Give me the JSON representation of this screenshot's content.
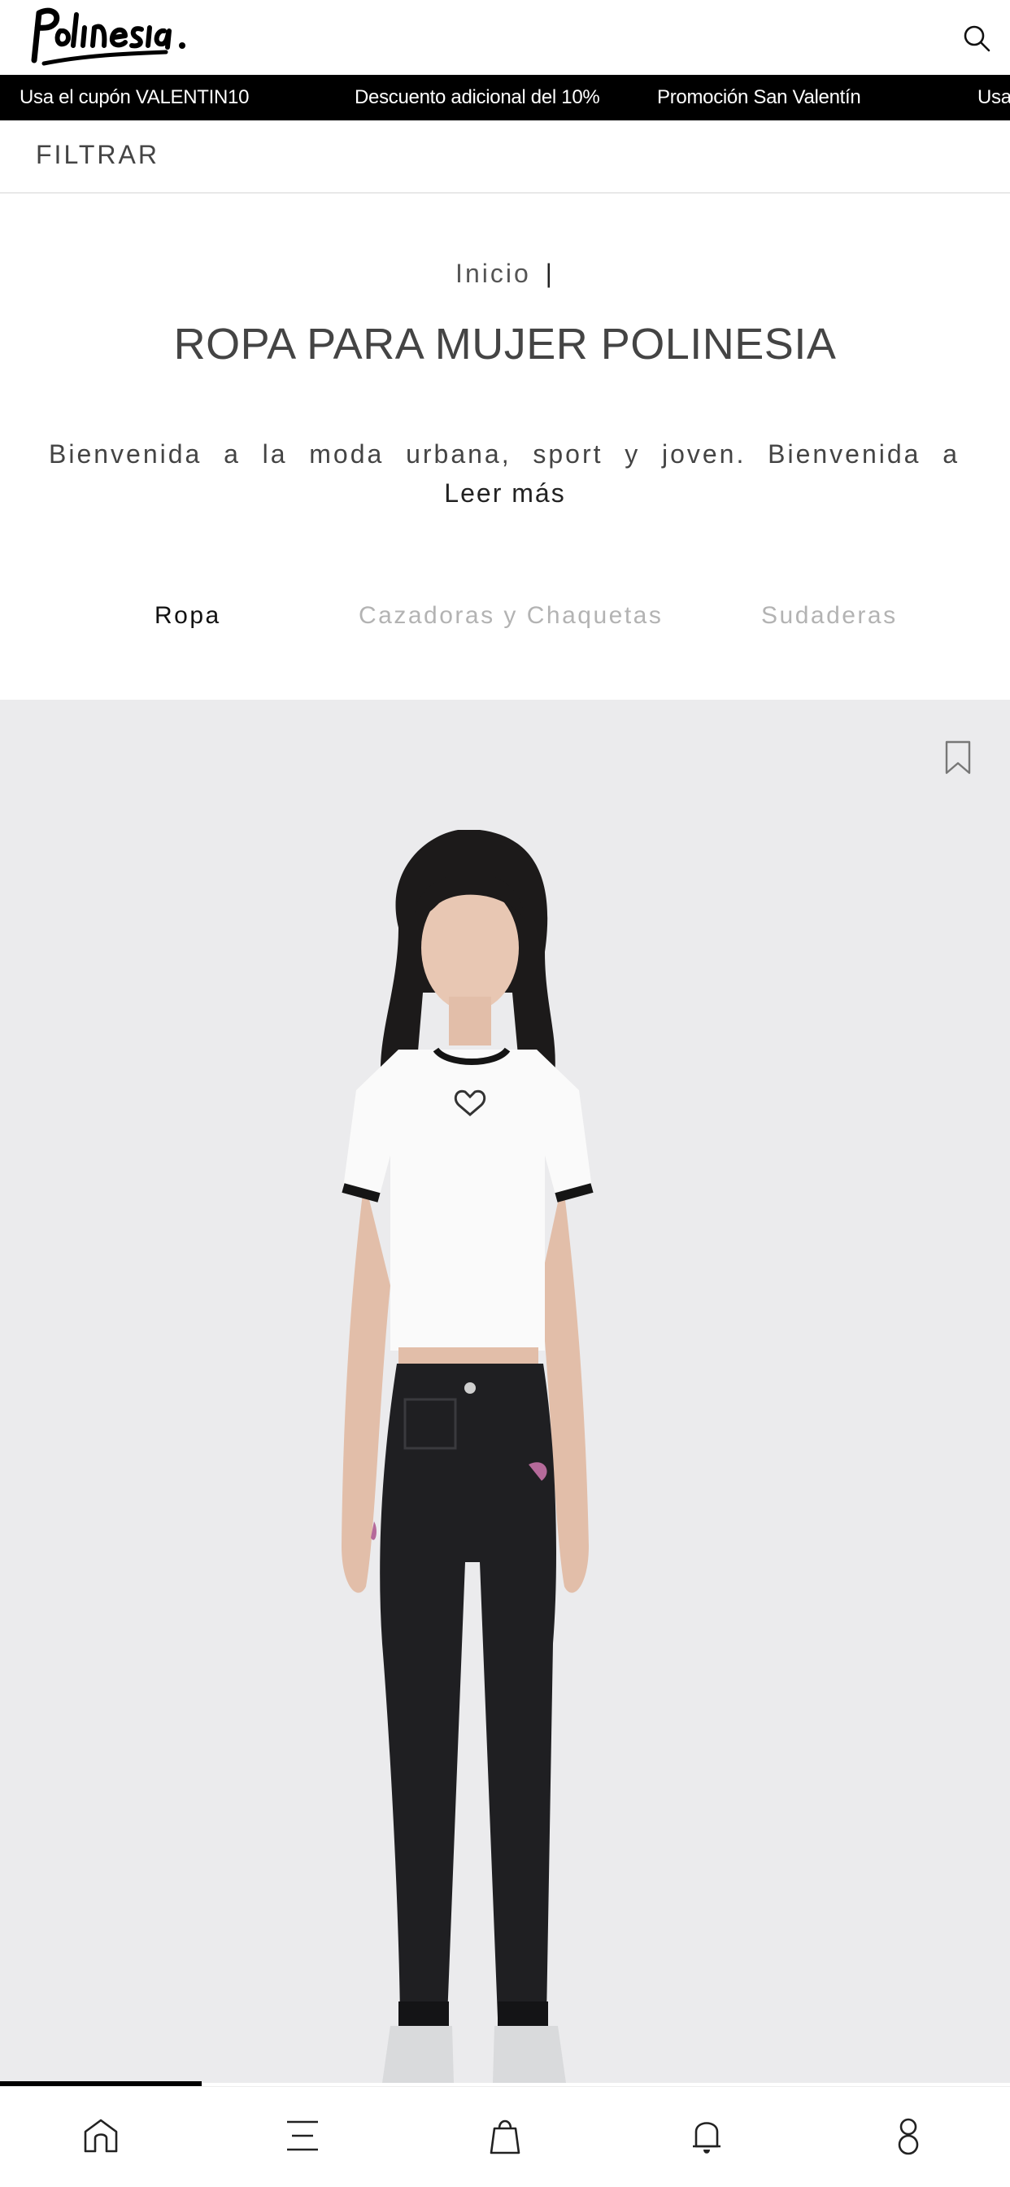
{
  "brand": {
    "logo_text": "Polinesia"
  },
  "promos": [
    "Usa el cupón VALENTIN10",
    "Descuento adicional del 10%",
    "Promoción San Valentín",
    "Usa"
  ],
  "filter": {
    "label": "FILTRAR"
  },
  "breadcrumb": {
    "home": "Inicio",
    "separator": "|"
  },
  "page": {
    "title": "ROPA PARA MUJER POLINESIA",
    "description": "Bienvenida a la moda urbana, sport y joven. Bienvenida a",
    "read_more": "Leer más"
  },
  "tabs": [
    {
      "label": "Ropa",
      "active": true
    },
    {
      "label": "Cazadoras y Chaquetas",
      "active": false
    },
    {
      "label": "Sudaderas",
      "active": false
    }
  ],
  "product": {
    "carousel_progress": 0.2
  },
  "colors": {
    "accent": "#000000",
    "background": "#ffffff",
    "product_bg": "#ebebed",
    "inactive_tab": "#b3b3b3"
  },
  "bottom_nav": [
    {
      "icon": "home-icon"
    },
    {
      "icon": "menu-icon"
    },
    {
      "icon": "bag-icon"
    },
    {
      "icon": "bell-icon"
    },
    {
      "icon": "user-icon"
    }
  ]
}
